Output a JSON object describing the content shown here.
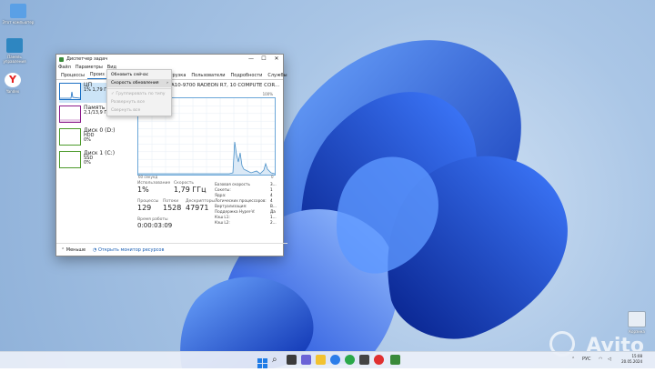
{
  "desktop": {
    "icons": [
      {
        "label": "Этот компьютер",
        "icon": "computer-icon"
      },
      {
        "label": "Панель управления",
        "icon": "control-panel-icon"
      },
      {
        "label": "Yandex",
        "icon": "yandex-icon"
      },
      {
        "label": "Корзина",
        "icon": "recycle-bin-icon"
      }
    ]
  },
  "window": {
    "title": "Диспетчер задач",
    "controls": {
      "minimize": "—",
      "maximize": "☐",
      "close": "✕"
    },
    "menu": [
      "Файл",
      "Параметры",
      "Вид"
    ],
    "tabs": [
      "Процессы",
      "Производительность",
      "Журнал приложений",
      "Автозагрузка",
      "Пользователи",
      "Подробности",
      "Службы"
    ],
    "tabs_visible": {
      "t0": "Процессы",
      "t1": "Произ",
      "t3": "Автозагрузка",
      "t4": "Пользователи",
      "t5": "Подробности",
      "t6": "Службы"
    },
    "resources": [
      {
        "name": "ЦП",
        "detail": "1% 1,79 ГГц",
        "color": "#1a6fc4"
      },
      {
        "name": "Память",
        "detail": "2,1/13,9 ГБ (15%)",
        "color": "#8b1a8b"
      },
      {
        "name": "Диск 0 (D:)",
        "detail": "HDD",
        "detail2": "0%",
        "color": "#4c9a2a"
      },
      {
        "name": "Диск 1 (C:)",
        "detail": "SSD",
        "detail2": "0%",
        "color": "#4c9a2a"
      }
    ],
    "cpu_title": "A10-9700 RADEON R7, 10 COMPUTE COR...",
    "graph": {
      "x_label": "60 секунд",
      "y_max": "100%",
      "y_min": "0"
    },
    "stats": {
      "usage_label": "Использование",
      "usage_value": "1%",
      "speed_label": "Скорость",
      "speed_value": "1,79 ГГц",
      "proc_label": "Процессы",
      "proc_value": "129",
      "threads_label": "Потоки",
      "threads_value": "1528",
      "handles_label": "Дескрипторы",
      "handles_value": "47971",
      "uptime_label": "Время работы",
      "uptime_value": "0:00:03:09"
    },
    "side_stats": [
      "Базовая скорость",
      "Сокеты:",
      "Ядра:",
      "Логических процессоров:",
      "Виртуализация:",
      "Поддержка Hyper-V:",
      "Кэш L1:",
      "Кэш L2:"
    ],
    "side_values": [
      "3...",
      "1",
      "4",
      "4",
      "В...",
      "Да",
      "1...",
      "2..."
    ],
    "bottom": {
      "less": "Меньше",
      "monitor": "Открыть монитор ресурсов"
    }
  },
  "context_menu": {
    "items": [
      {
        "label": "Обновить сейчас",
        "disabled": false
      },
      {
        "label": "Скорость обновления",
        "disabled": false,
        "arrow": "›"
      },
      {
        "label": "Группировать по типу",
        "disabled": true
      },
      {
        "label": "Развернуть все",
        "disabled": true
      },
      {
        "label": "Свернуть все",
        "disabled": true
      }
    ]
  },
  "taskbar": {
    "lang": "РУС",
    "time": "15:08",
    "date": "20.05.2024"
  },
  "watermark": "Avito",
  "colors": {
    "accent": "#1a6fc4",
    "memory": "#8b1a8b",
    "disk": "#4c9a2a",
    "graph_line": "#4a90c8"
  }
}
